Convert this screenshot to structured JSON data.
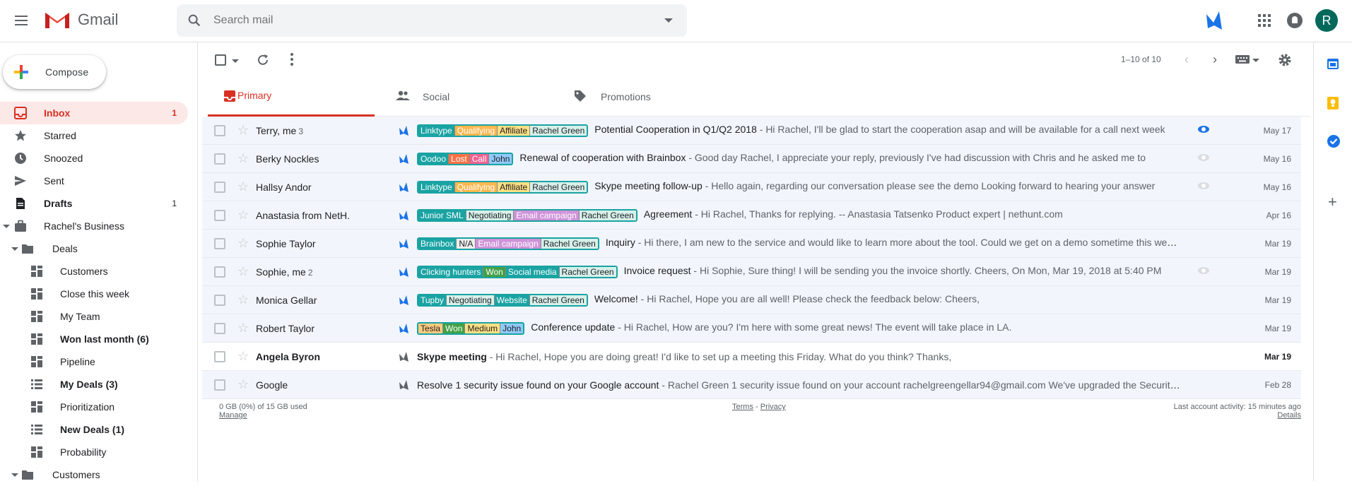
{
  "app": {
    "name": "Gmail"
  },
  "search": {
    "placeholder": "Search mail"
  },
  "account": {
    "avatar_letter": "R"
  },
  "compose": {
    "label": "Compose"
  },
  "nav": {
    "items": [
      {
        "label": "Inbox",
        "count": "1"
      },
      {
        "label": "Starred",
        "count": ""
      },
      {
        "label": "Snoozed",
        "count": ""
      },
      {
        "label": "Sent",
        "count": ""
      },
      {
        "label": "Drafts",
        "count": "1"
      },
      {
        "label": "Rachel's Business",
        "count": ""
      },
      {
        "label": "Deals",
        "count": ""
      },
      {
        "label": "Customers",
        "count": ""
      },
      {
        "label": "Close this week",
        "count": ""
      },
      {
        "label": "My Team",
        "count": ""
      },
      {
        "label": "Won last month (6)",
        "count": ""
      },
      {
        "label": "Pipeline",
        "count": ""
      },
      {
        "label": "My Deals (3)",
        "count": ""
      },
      {
        "label": "Prioritization",
        "count": ""
      },
      {
        "label": "New Deals (1)",
        "count": ""
      },
      {
        "label": "Probability",
        "count": ""
      },
      {
        "label": "Customers",
        "count": ""
      }
    ]
  },
  "toolbar": {
    "pagination": "1–10 of 10"
  },
  "tabs": [
    {
      "label": "Primary"
    },
    {
      "label": "Social"
    },
    {
      "label": "Promotions"
    }
  ],
  "emails": [
    {
      "sender": "Terry, me",
      "count": "3",
      "tags": [
        "Linktype",
        "Qualifying",
        "Affiliate",
        "Rachel Green"
      ],
      "subject": "Potential Cooperation in Q1/Q2 2018",
      "snippet": " - Hi Rachel, I'll be glad to start the cooperation asap and will be available for a call next week",
      "date": "May 17"
    },
    {
      "sender": "Berky Nockles",
      "count": "",
      "tags": [
        "Oodoo",
        "Lost",
        "Call",
        "John"
      ],
      "subject": "Renewal of cooperation with Brainbox",
      "snippet": " - Good day Rachel, I appreciate your reply, previously I've had discussion with Chris and he asked me to",
      "date": "May 16"
    },
    {
      "sender": "Hallsy Andor",
      "count": "",
      "tags": [
        "Linktype",
        "Qualifying",
        "Affiliate",
        "Rachel Green"
      ],
      "subject": "Skype meeting follow-up",
      "snippet": " - Hello again, regarding our conversation please see the demo Looking forward to hearing your answer",
      "date": "May 16"
    },
    {
      "sender": "Anastasia from NetH.",
      "count": "",
      "tags": [
        "Junior SML",
        "Negotiating",
        "Email campaign",
        "Rachel Green"
      ],
      "subject": "Agreement",
      "snippet": " - Hi Rachel, Thanks for replying. -- Anastasia Tatsenko Product expert | nethunt.com",
      "date": "Apr 16"
    },
    {
      "sender": "Sophie Taylor",
      "count": "",
      "tags": [
        "Brainbox",
        "N/A",
        "Email campaign",
        "Rachel Green"
      ],
      "subject": "Inquiry",
      "snippet": " - Hi there, I am new to the service and would like to learn more about the tool. Could we get on a demo sometime this week?",
      "date": "Mar 19"
    },
    {
      "sender": "Sophie, me",
      "count": "2",
      "tags": [
        "Clicking hunters",
        "Won",
        "Social media",
        "Rachel Green"
      ],
      "subject": "Invoice request",
      "snippet": " - Hi Sophie, Sure thing! I will be sending you the invoice shortly. Cheers, On Mon, Mar 19, 2018 at 5:40 PM",
      "date": "Mar 19"
    },
    {
      "sender": "Monica Gellar",
      "count": "",
      "tags": [
        "Tupby",
        "Negotiating",
        "Website",
        "Rachel Green"
      ],
      "subject": "Welcome!",
      "snippet": " - Hi Rachel, Hope you are all well! Please check the feedback below: Cheers,",
      "date": "Mar 19"
    },
    {
      "sender": "Robert Taylor",
      "count": "",
      "tags": [
        "Tesla",
        "Won",
        "Medium",
        "John"
      ],
      "subject": "Conference update",
      "snippet": " - Hi Rachel, How are you? I'm here with some great news! The event will take place in LA.",
      "date": "Mar 19"
    },
    {
      "sender": "Angela Byron",
      "count": "",
      "tags": [],
      "subject": "Skype meeting",
      "snippet": " - Hi Rachel, Hope you are doing great! I'd like to set up a meeting this Friday. What do you think? Thanks,",
      "date": "Mar 19"
    },
    {
      "sender": "Google",
      "count": "",
      "tags": [],
      "subject": "Resolve 1 security issue found on your Google account",
      "snippet": " - Rachel Green 1 security issue found on your account rachelgreengellar94@gmail.com We've upgraded the Security Checkup",
      "date": "Feb 28"
    }
  ],
  "footer": {
    "storage": "0 GB (0%) of 15 GB used",
    "manage": "Manage",
    "terms": "Terms",
    "sep": " - ",
    "privacy": "Privacy",
    "activity": "Last account activity: 15 minutes ago",
    "details": "Details"
  }
}
